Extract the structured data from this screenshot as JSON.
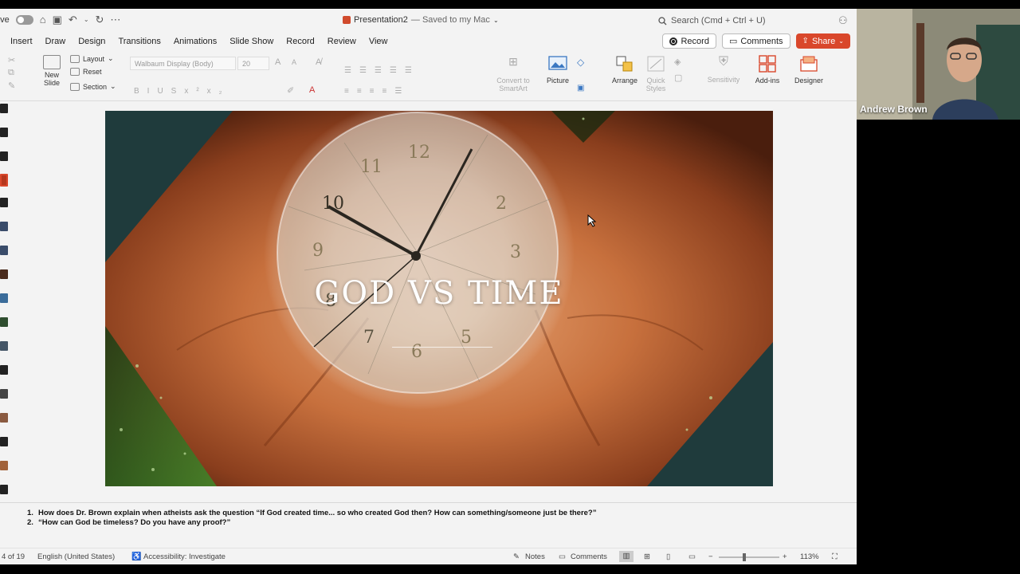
{
  "titlebar": {
    "autosave_label": "ave",
    "doc_title": "Presentation2",
    "saved_status": "— Saved to my Mac",
    "search_placeholder": "Search (Cmd + Ctrl + U)"
  },
  "tabs": [
    "Insert",
    "Draw",
    "Design",
    "Transitions",
    "Animations",
    "Slide Show",
    "Record",
    "Review",
    "View"
  ],
  "actions": {
    "record_label": "Record",
    "comments_label": "Comments",
    "share_label": "Share",
    "share_color": "#d9472b"
  },
  "ribbon": {
    "new_slide": "New\nSlide",
    "layout": "Layout",
    "reset": "Reset",
    "section": "Section",
    "font_name": "Walbaum Display (Body)",
    "font_size": "20",
    "convert_smartart": "Convert to\nSmartArt",
    "picture": "Picture",
    "arrange": "Arrange",
    "quick_styles": "Quick\nStyles",
    "sensitivity": "Sensitivity",
    "addins": "Add-ins",
    "designer": "Designer"
  },
  "slide": {
    "title": "GOD VS TIME",
    "clock_numerals": [
      "12",
      "11",
      "10",
      "2",
      "9",
      "3",
      "8",
      "7",
      "6",
      "5"
    ]
  },
  "notes": [
    {
      "num": "1.",
      "text": "How does Dr. Brown explain when atheists ask the question “If God created time... so who created God then? How can something/someone just be there?”"
    },
    {
      "num": "2.",
      "text": "“How can God be timeless? Do you have any proof?”"
    }
  ],
  "status": {
    "slide_position": "4 of 19",
    "language": "English (United States)",
    "accessibility": "Accessibility: Investigate",
    "notes_label": "Notes",
    "comments_label": "Comments",
    "zoom": "113%"
  },
  "video": {
    "participant_name": "Andrew Brown"
  }
}
